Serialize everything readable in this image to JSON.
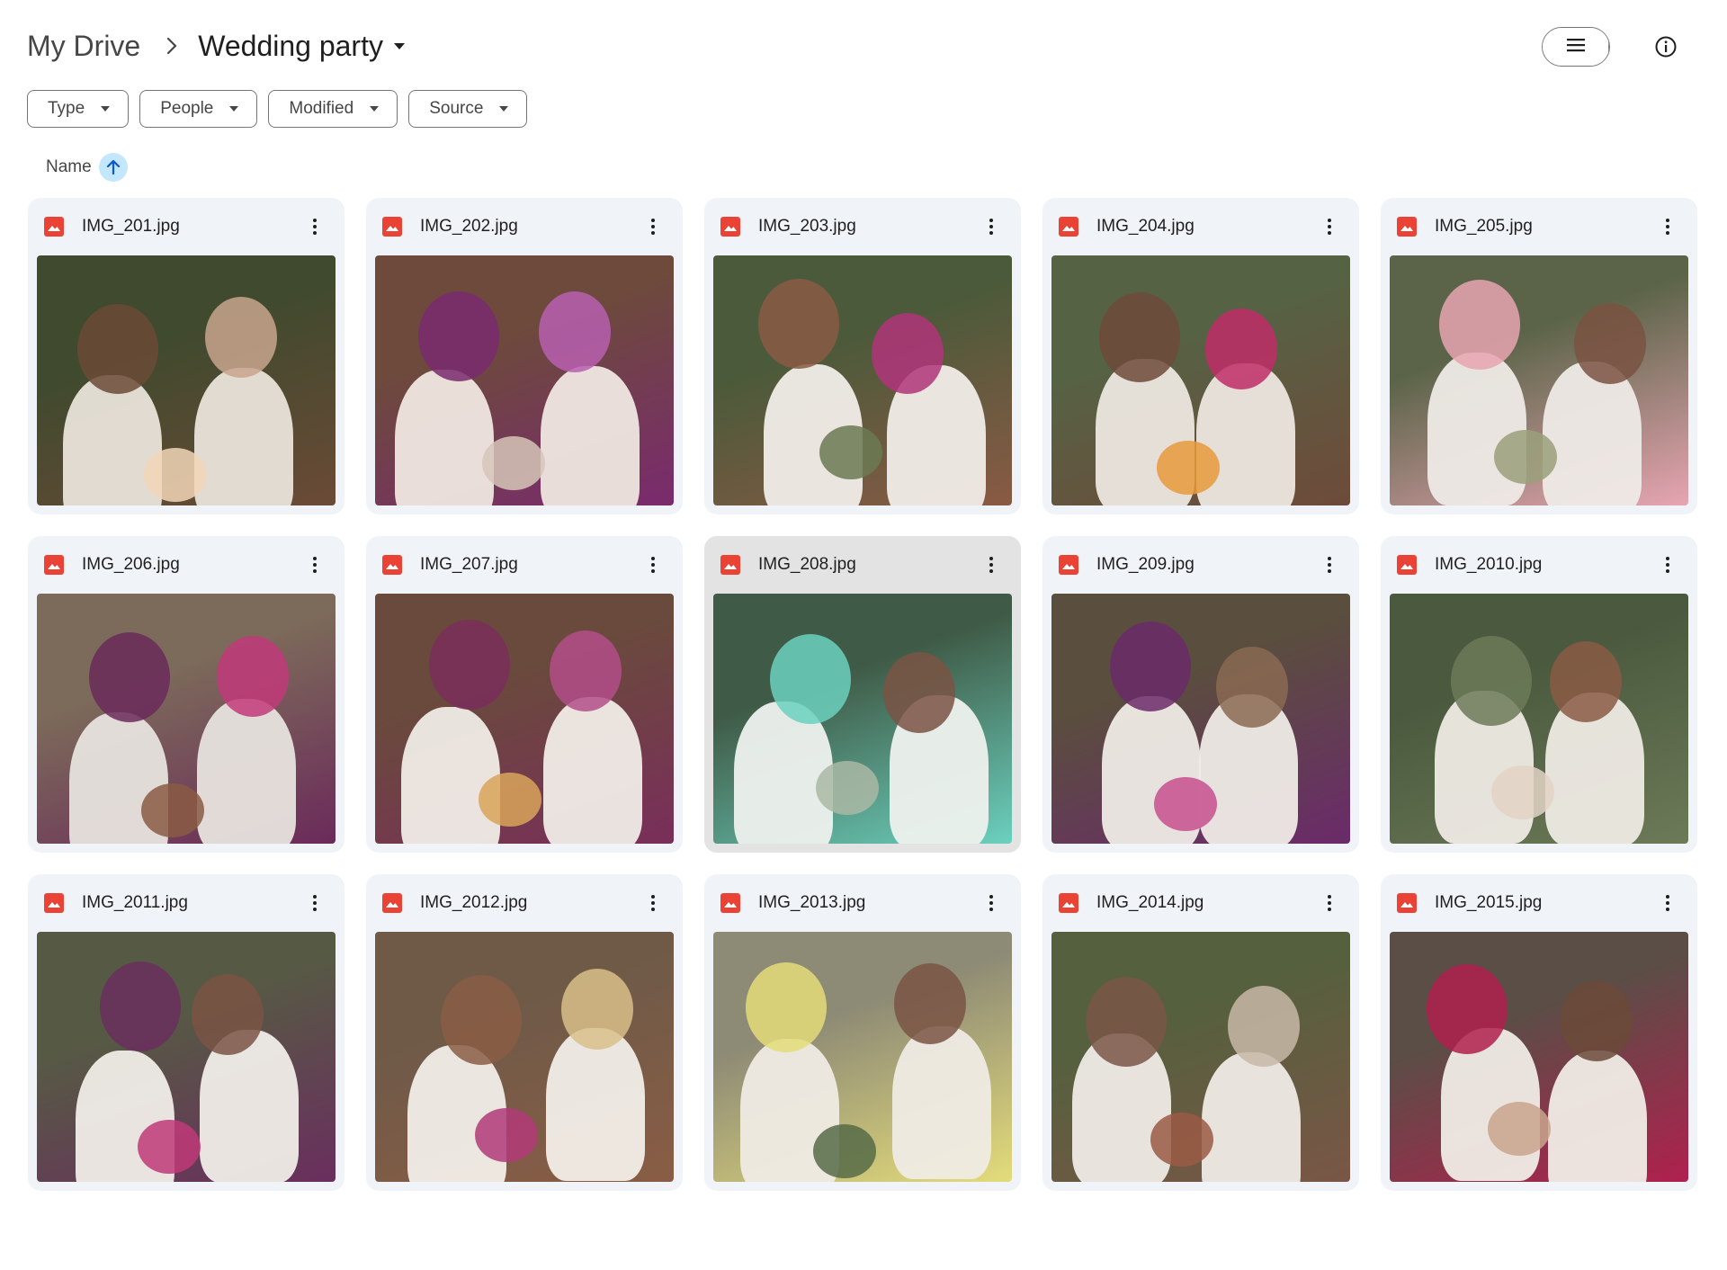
{
  "breadcrumb": {
    "root": "My Drive",
    "current": "Wedding party"
  },
  "filters": [
    "Type",
    "People",
    "Modified",
    "Source"
  ],
  "sort": {
    "label": "Name"
  },
  "icons": {
    "breadcrumb_separator": "chevron-right-icon",
    "list_view": "list-view-icon",
    "grid_view": "grid-view-icon",
    "checkmark": "checkmark-icon",
    "info": "info-icon",
    "sort_direction": "arrow-up-icon",
    "file_type": "image-file-icon",
    "more": "more-vert-icon"
  },
  "colors": {
    "accent": "#c2e7ff",
    "image_icon": "#ea4335",
    "card_bg": "#f0f4f9",
    "card_selected_bg": "#e3e3e3"
  },
  "files": [
    {
      "name": "IMG_201.jpg",
      "selected": false
    },
    {
      "name": "IMG_202.jpg",
      "selected": false
    },
    {
      "name": "IMG_203.jpg",
      "selected": false
    },
    {
      "name": "IMG_204.jpg",
      "selected": false
    },
    {
      "name": "IMG_205.jpg",
      "selected": false
    },
    {
      "name": "IMG_206.jpg",
      "selected": false
    },
    {
      "name": "IMG_207.jpg",
      "selected": false
    },
    {
      "name": "IMG_208.jpg",
      "selected": true
    },
    {
      "name": "IMG_209.jpg",
      "selected": false
    },
    {
      "name": "IMG_2010.jpg",
      "selected": false
    },
    {
      "name": "IMG_2011.jpg",
      "selected": false
    },
    {
      "name": "IMG_2012.jpg",
      "selected": false
    },
    {
      "name": "IMG_2013.jpg",
      "selected": false
    },
    {
      "name": "IMG_2014.jpg",
      "selected": false
    },
    {
      "name": "IMG_2015.jpg",
      "selected": false
    }
  ]
}
